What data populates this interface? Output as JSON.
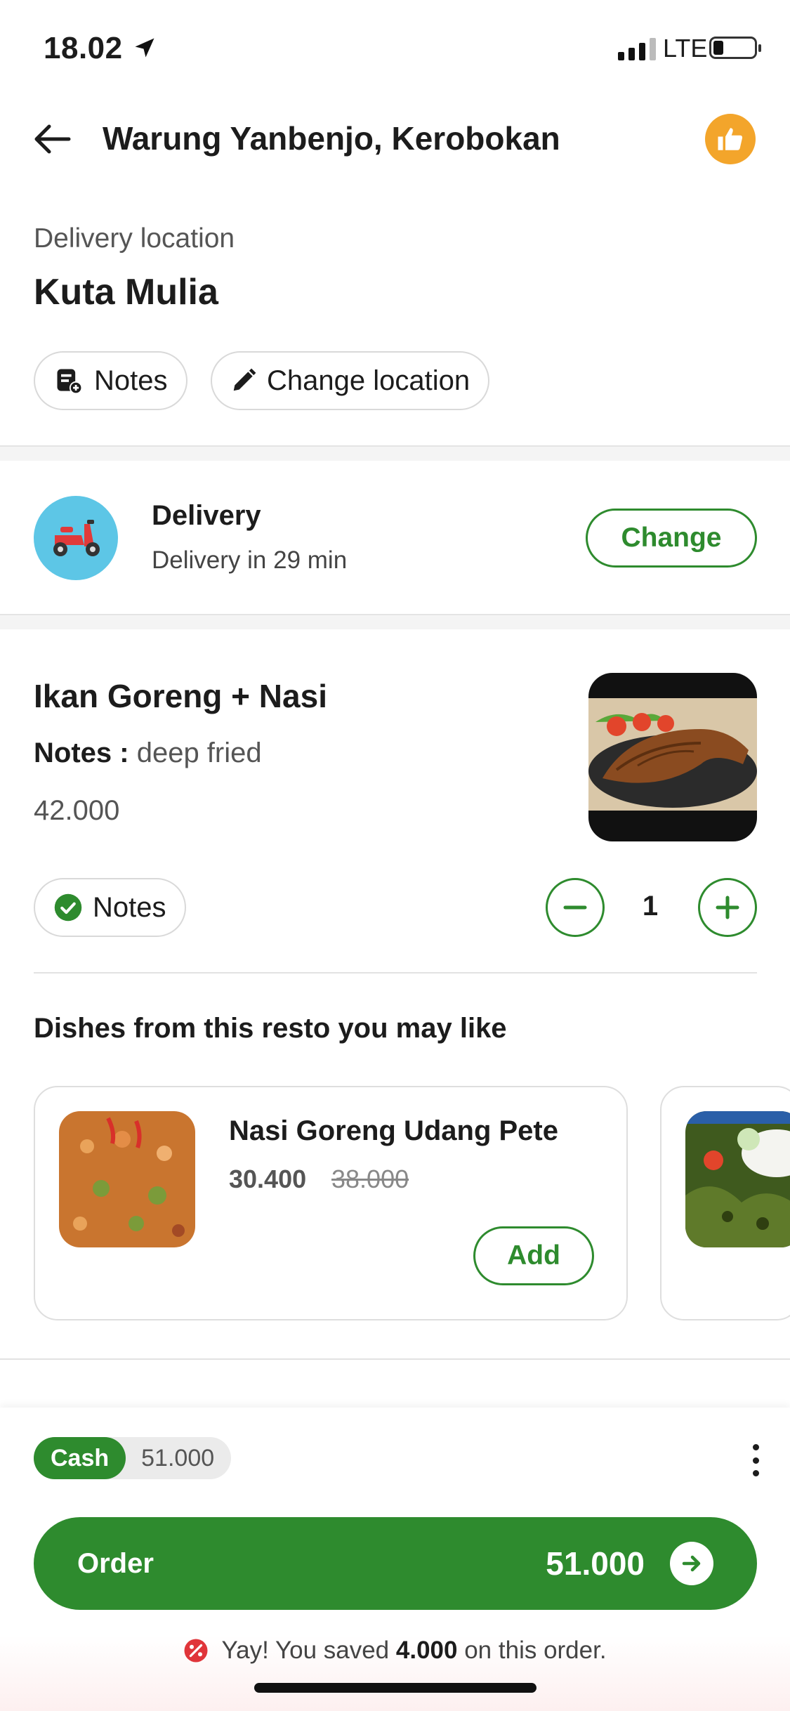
{
  "status_bar": {
    "time": "18.02",
    "network": "LTE"
  },
  "header": {
    "title": "Warung Yanbenjo, Kerobokan"
  },
  "location": {
    "label": "Delivery location",
    "name": "Kuta Mulia",
    "notes_button": "Notes",
    "change_button": "Change location"
  },
  "delivery": {
    "title": "Delivery",
    "subtitle": "Delivery in 29 min",
    "change_button": "Change"
  },
  "item": {
    "name": "Ikan Goreng + Nasi",
    "notes_label": "Notes :",
    "notes_value": "deep fried",
    "price": "42.000",
    "notes_button": "Notes",
    "quantity": "1"
  },
  "recommendations": {
    "title": "Dishes from this resto you may like",
    "items": [
      {
        "name": "Nasi Goreng Udang Pete",
        "price": "30.400",
        "old_price": "38.000",
        "add_button": "Add"
      }
    ]
  },
  "checkout": {
    "payment_method": "Cash",
    "payment_amount": "51.000",
    "order_label": "Order",
    "order_total": "51.000",
    "saving_prefix": "Yay! You saved",
    "saving_amount": "4.000",
    "saving_suffix": "on this order."
  },
  "colors": {
    "primary_green": "#2e8b2e",
    "like_orange": "#f3a52b",
    "scooter_bg": "#5dc6e6"
  },
  "icons": [
    "location-arrow-icon",
    "signal-icon",
    "battery-icon",
    "back-arrow-icon",
    "thumbs-up-icon",
    "notes-icon",
    "pencil-icon",
    "scooter-icon",
    "check-circle-icon",
    "minus-icon",
    "plus-icon",
    "more-vertical-icon",
    "arrow-right-icon",
    "discount-icon"
  ]
}
